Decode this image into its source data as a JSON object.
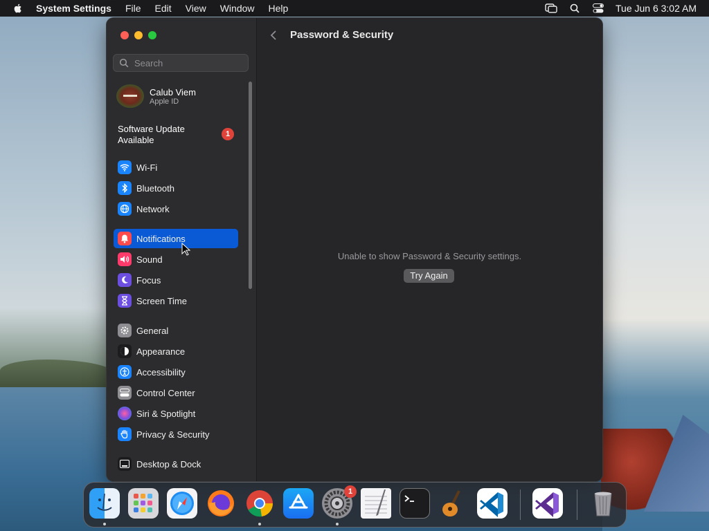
{
  "menubar": {
    "app_name": "System Settings",
    "menus": [
      "File",
      "Edit",
      "View",
      "Window",
      "Help"
    ],
    "clock": "Tue Jun 6  3:02 AM",
    "icons": [
      "apple-icon",
      "screen-mirroring-icon",
      "spotlight-search-icon",
      "control-center-icon"
    ]
  },
  "sidebar": {
    "search_placeholder": "Search",
    "profile": {
      "name": "Calub Viem",
      "subtitle": "Apple ID"
    },
    "update": {
      "label": "Software Update Available",
      "badge": "1"
    },
    "items": [
      {
        "label": "Wi-Fi",
        "icon": "wifi-icon",
        "color": "#1a84ff"
      },
      {
        "label": "Bluetooth",
        "icon": "bluetooth-icon",
        "color": "#1a84ff"
      },
      {
        "label": "Network",
        "icon": "globe-icon",
        "color": "#1a84ff"
      },
      {
        "label": "Notifications",
        "icon": "bell-icon",
        "color": "#ff4b4b"
      },
      {
        "label": "Sound",
        "icon": "speaker-icon",
        "color": "#ff3b6b"
      },
      {
        "label": "Focus",
        "icon": "moon-icon",
        "color": "#6c4fe0"
      },
      {
        "label": "Screen Time",
        "icon": "hourglass-icon",
        "color": "#6c4fe0"
      },
      {
        "label": "General",
        "icon": "gear-icon",
        "color": "#8e8e93"
      },
      {
        "label": "Appearance",
        "icon": "appearance-icon",
        "color": "#1c1c1e"
      },
      {
        "label": "Accessibility",
        "icon": "accessibility-icon",
        "color": "#1a84ff"
      },
      {
        "label": "Control Center",
        "icon": "control-center-icon",
        "color": "#8e8e93"
      },
      {
        "label": "Siri & Spotlight",
        "icon": "siri-icon",
        "color": "#b04fd8"
      },
      {
        "label": "Privacy & Security",
        "icon": "hand-icon",
        "color": "#1a84ff"
      },
      {
        "label": "Desktop & Dock",
        "icon": "dock-icon",
        "color": "#1c1c1e"
      }
    ],
    "selected": "Notifications"
  },
  "content": {
    "title": "Password & Security",
    "message": "Unable to show Password & Security settings.",
    "try_again": "Try Again"
  },
  "dock": {
    "apps": [
      "Finder",
      "Launchpad",
      "Safari",
      "Firefox",
      "Chrome",
      "App Store",
      "System Settings",
      "TextEdit",
      "Terminal",
      "GarageBand",
      "Visual Studio Code",
      "Visual Studio",
      "Trash"
    ],
    "settings_badge": "1"
  },
  "colors": {
    "accent": "#0a5ad6",
    "badge": "#e0433a"
  }
}
